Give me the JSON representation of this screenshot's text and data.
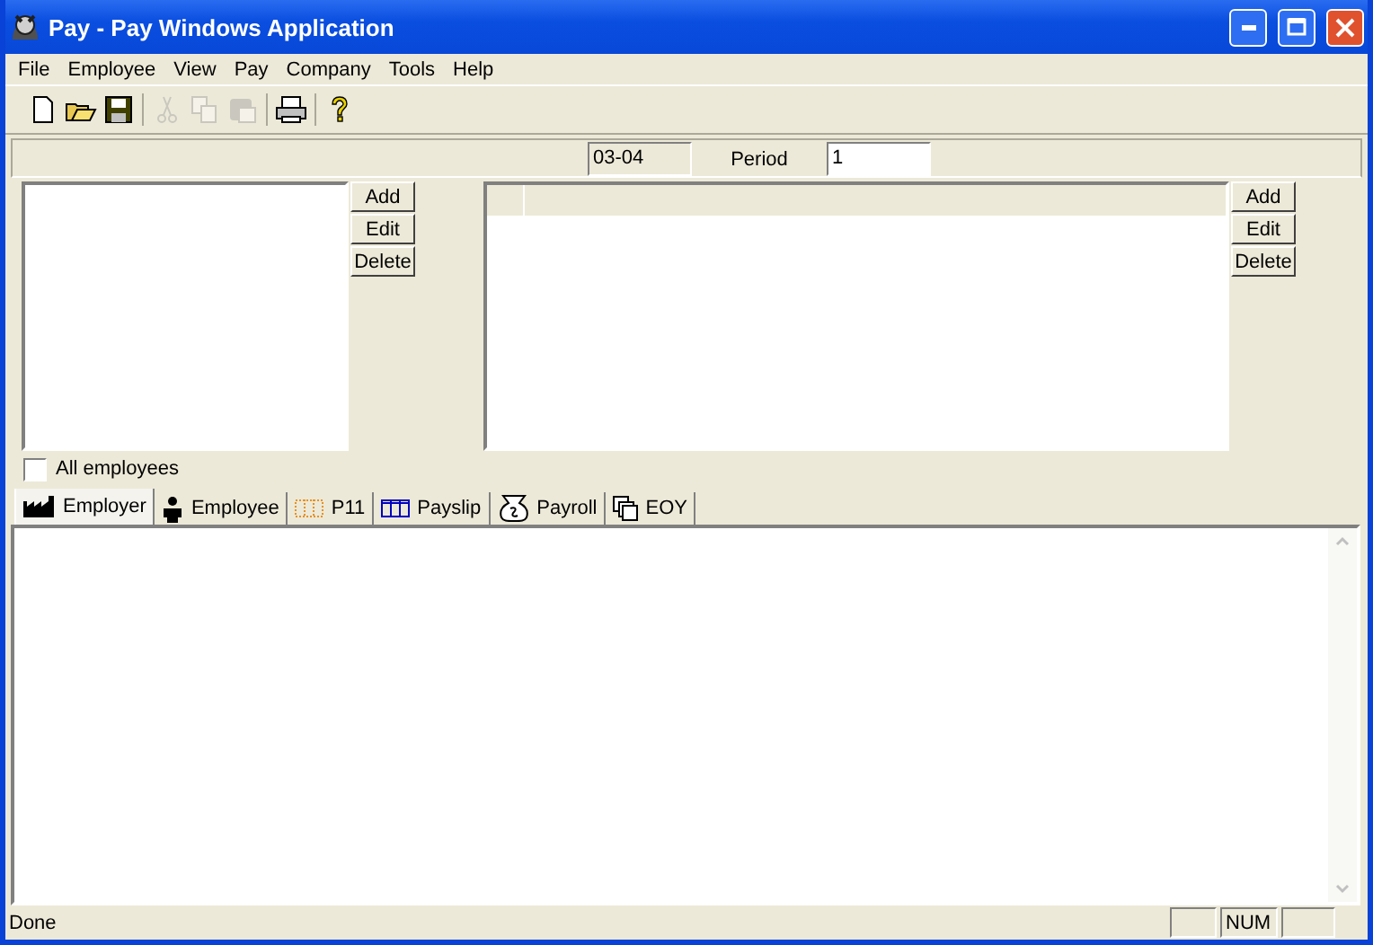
{
  "window": {
    "title": "Pay - Pay Windows Application"
  },
  "menu": [
    "File",
    "Employee",
    "View",
    "Pay",
    "Company",
    "Tools",
    "Help"
  ],
  "toolbar": [
    [
      {
        "kind": "new",
        "disabled": false
      },
      {
        "kind": "open",
        "disabled": false
      },
      {
        "kind": "save",
        "disabled": false
      }
    ],
    [
      {
        "kind": "cut",
        "disabled": true
      },
      {
        "kind": "copy",
        "disabled": true
      },
      {
        "kind": "paste",
        "disabled": true
      }
    ],
    [
      {
        "kind": "print",
        "disabled": false
      }
    ],
    [
      {
        "kind": "help",
        "disabled": false
      }
    ]
  ],
  "info_bar": {
    "year": "03-04",
    "period_label": "Period",
    "period_value": "1"
  },
  "employee_list": {
    "buttons": [
      "Add",
      "Edit",
      "Delete"
    ]
  },
  "pay_items": {
    "buttons": [
      "Add",
      "Edit",
      "Delete"
    ]
  },
  "all_employees": {
    "label": "All employees",
    "checked": false
  },
  "tabs": [
    {
      "label": "Employer",
      "kind": "factory",
      "selected": true
    },
    {
      "label": "Employee",
      "kind": "person",
      "selected": false
    },
    {
      "label": "P11",
      "kind": "dotted",
      "selected": false
    },
    {
      "label": "Payslip",
      "kind": "grid",
      "selected": false
    },
    {
      "label": "Payroll",
      "kind": "bag",
      "selected": false
    },
    {
      "label": "EOY",
      "kind": "copies",
      "selected": false
    }
  ],
  "status_bar": {
    "text": "Done",
    "indicator": "NUM"
  }
}
